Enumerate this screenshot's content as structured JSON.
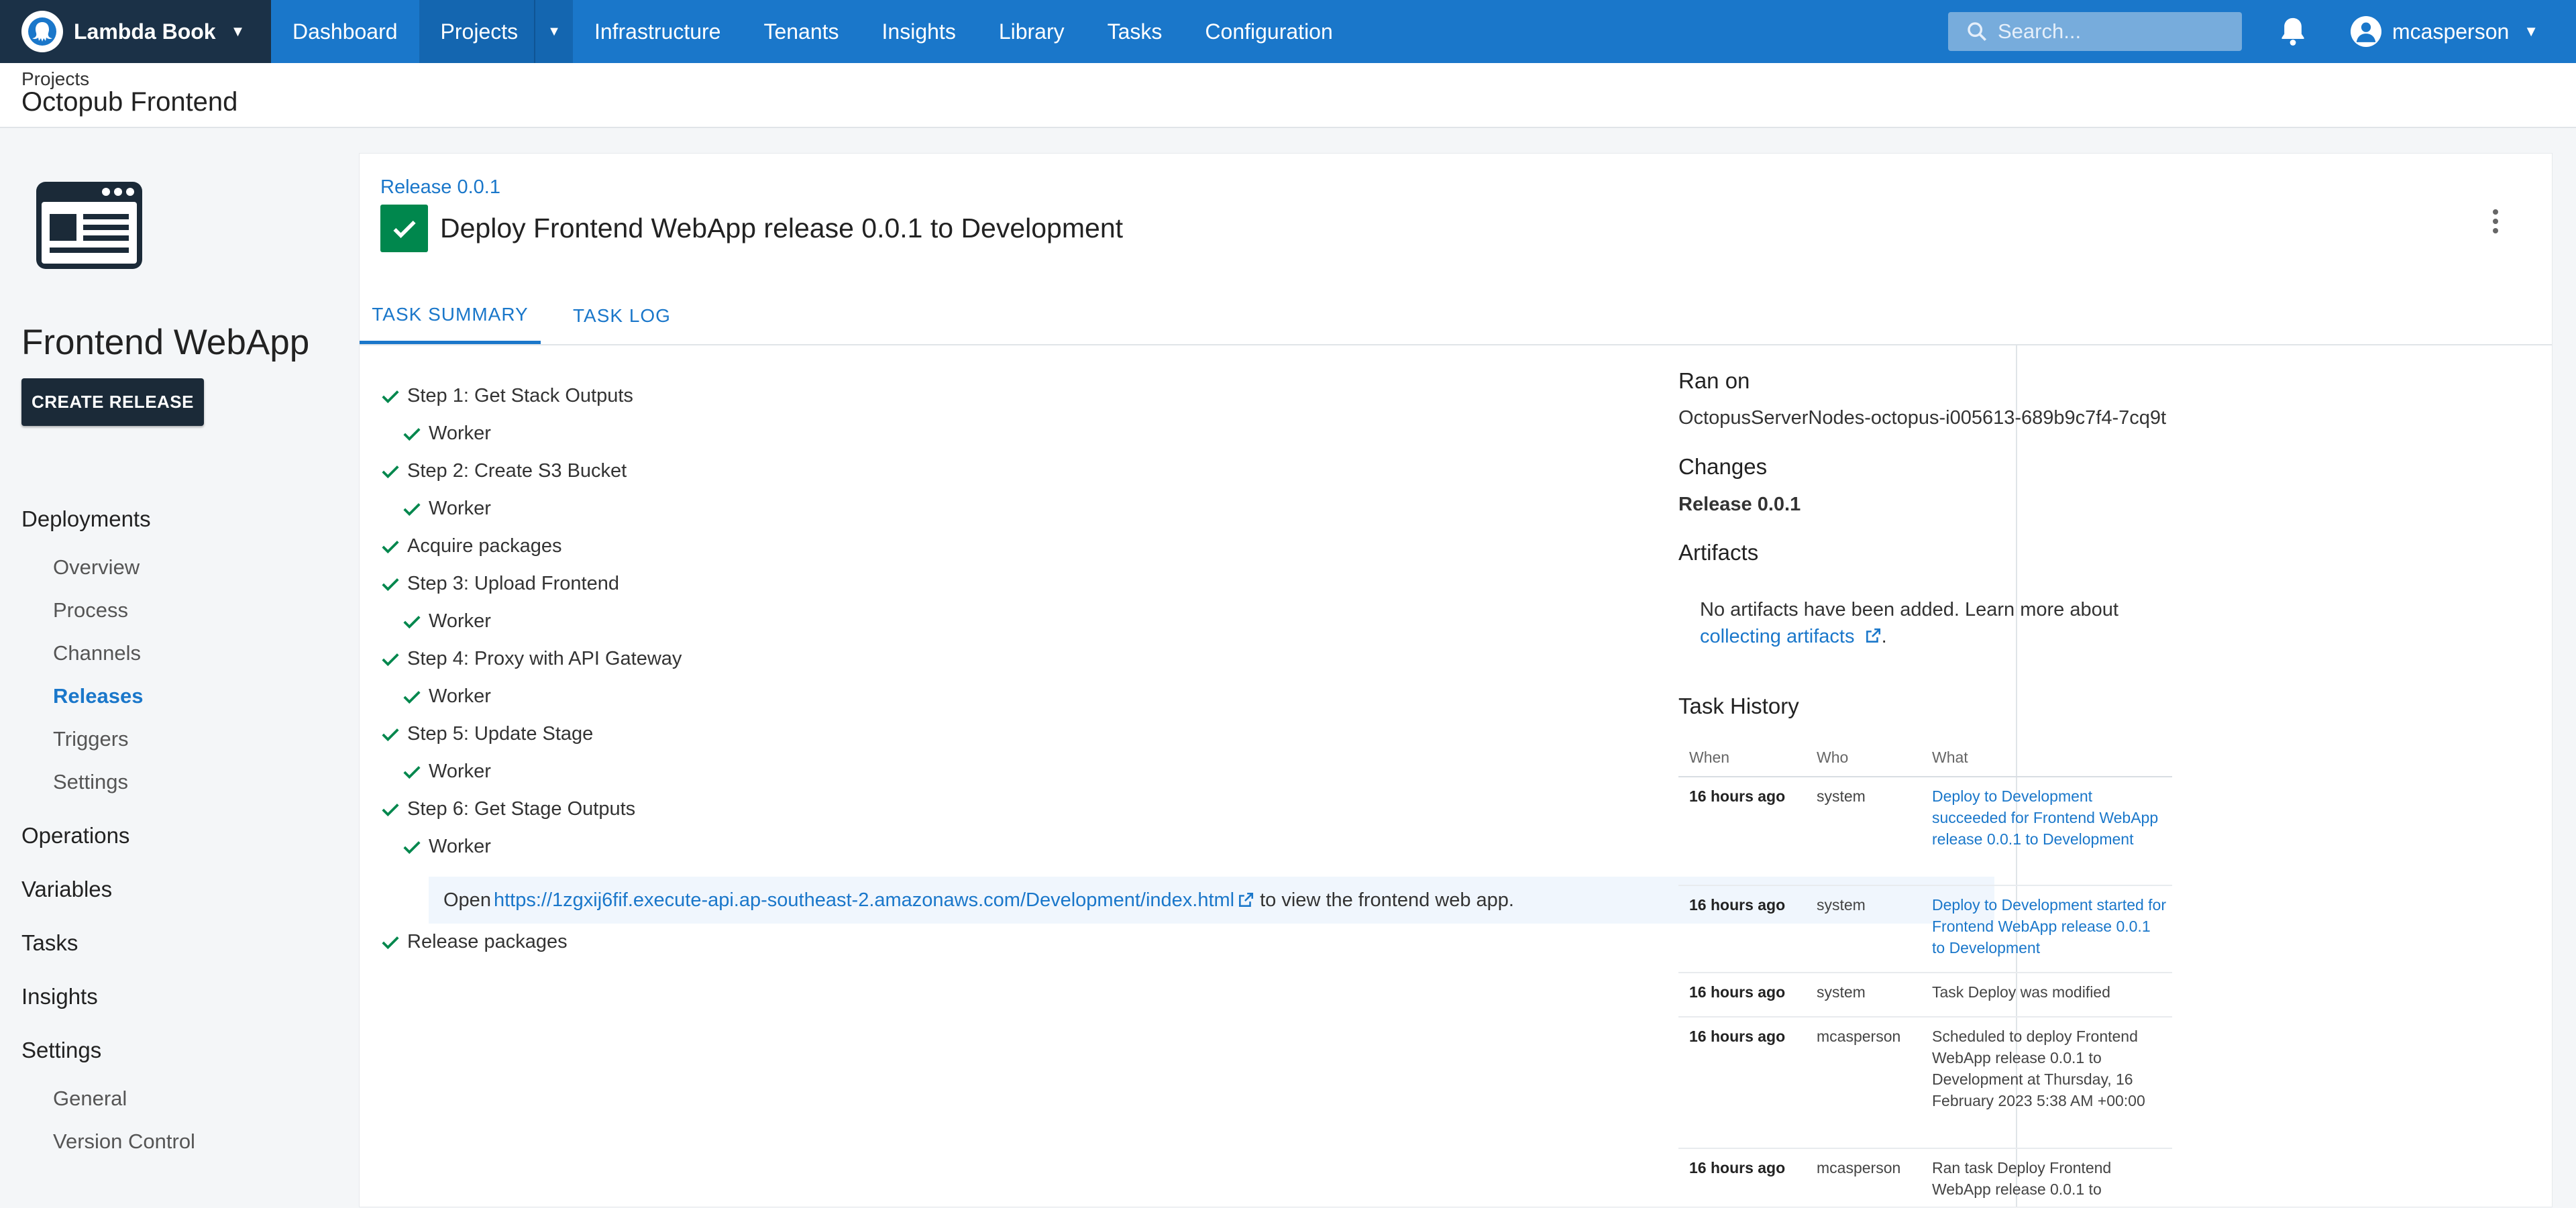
{
  "topbar": {
    "space_name": "Lambda Book",
    "nav": [
      "Dashboard",
      "Projects",
      "Infrastructure",
      "Tenants",
      "Insights",
      "Library",
      "Tasks",
      "Configuration"
    ],
    "search_placeholder": "Search...",
    "username": "mcasperson",
    "accent": "#1a77ca",
    "space_bg": "#1b3147"
  },
  "header": {
    "breadcrumb": "Projects",
    "title": "Octopub Frontend"
  },
  "sidebar": {
    "project_name": "Frontend WebApp",
    "create_release": "CREATE RELEASE",
    "deployments_head": "Deployments",
    "deploy_links": [
      "Overview",
      "Process",
      "Channels",
      "Releases",
      "Triggers",
      "Settings"
    ],
    "operations": "Operations",
    "variables": "Variables",
    "tasks": "Tasks",
    "insights": "Insights",
    "settings_head": "Settings",
    "settings_links": [
      "General",
      "Version Control"
    ]
  },
  "task": {
    "release_link": "Release 0.0.1",
    "title": "Deploy Frontend WebApp release 0.0.1 to Development",
    "status_color": "#00874d",
    "tabs": [
      "TASK SUMMARY",
      "TASK LOG"
    ],
    "steps": [
      "Step 1: Get Stack Outputs",
      "Worker",
      "Step 2: Create S3 Bucket",
      "Worker",
      "Acquire packages",
      "Step 3: Upload Frontend",
      "Worker",
      "Step 4: Proxy with API Gateway",
      "Worker",
      "Step 5: Update Stage",
      "Worker",
      "Step 6: Get Stage Outputs",
      "Worker",
      "Release packages"
    ],
    "output_prefix": "Open",
    "output_url": "https://1zgxij6fif.execute-api.ap-southeast-2.amazonaws.com/Development/index.html",
    "output_suffix": "to view the frontend web app."
  },
  "panel": {
    "ran_on_head": "Ran on",
    "ran_on_value": "OctopusServerNodes-octopus-i005613-689b9c7f4-7cq9t",
    "changes_head": "Changes",
    "changes_value": "Release 0.0.1",
    "artifacts_head": "Artifacts",
    "artifacts_text": "No artifacts have been added. Learn more about",
    "artifacts_link": "collecting artifacts",
    "history_head": "Task History",
    "history_cols": [
      "When",
      "Who",
      "What"
    ],
    "history": [
      {
        "when": "16 hours ago",
        "who": "system",
        "what": "Deploy to Development succeeded for Frontend WebApp release 0.0.1 to Development"
      },
      {
        "when": "16 hours ago",
        "who": "system",
        "what": "Deploy to Development started for Frontend WebApp release 0.0.1 to Development"
      },
      {
        "when": "16 hours ago",
        "who": "system",
        "what": "Task Deploy was modified"
      },
      {
        "when": "16 hours ago",
        "who": "mcasperson",
        "what": "Scheduled to deploy Frontend WebApp release 0.0.1 to Development at Thursday, 16 February 2023 5:38 AM +00:00"
      },
      {
        "when": "16 hours ago",
        "who": "mcasperson",
        "what": "Ran task Deploy Frontend WebApp release 0.0.1 to"
      }
    ]
  }
}
